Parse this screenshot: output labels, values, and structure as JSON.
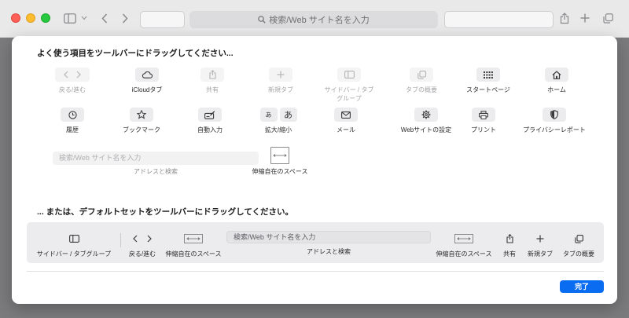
{
  "toolbar": {
    "search_placeholder": "検索/Web サイト名を入力"
  },
  "sheet": {
    "heading_items": "よく使う項目をツールバーにドラッグしてください...",
    "heading_default": "... または、デフォルトセットをツールバーにドラッグしてください。",
    "items_row1": [
      {
        "label": "戻る/進む",
        "icon": "back-forward-icon",
        "enabled": false
      },
      {
        "label": "iCloudタブ",
        "icon": "cloud-icon",
        "enabled": true
      },
      {
        "label": "共有",
        "icon": "share-icon",
        "enabled": false
      },
      {
        "label": "新規タブ",
        "icon": "plus-icon",
        "enabled": false
      },
      {
        "label": "サイドバー / タブ\nグループ",
        "icon": "sidebar-icon",
        "enabled": false
      },
      {
        "label": "タブの概要",
        "icon": "tab-overview-icon",
        "enabled": false
      },
      {
        "label": "スタートページ",
        "icon": "grid-icon",
        "enabled": true
      },
      {
        "label": "ホーム",
        "icon": "home-icon",
        "enabled": true
      }
    ],
    "items_row2": [
      {
        "label": "履歴",
        "icon": "clock-icon",
        "enabled": true
      },
      {
        "label": "ブックマーク",
        "icon": "star-icon",
        "enabled": true
      },
      {
        "label": "自動入力",
        "icon": "autofill-icon",
        "enabled": true
      },
      {
        "label": "拡大/縮小",
        "icon": "text-size-icon",
        "enabled": true,
        "glyphs": [
          "あ",
          "あ"
        ]
      },
      {
        "label": "メール",
        "icon": "mail-icon",
        "enabled": true
      },
      {
        "label": "Webサイトの設定",
        "icon": "gear-icon",
        "enabled": true
      },
      {
        "label": "プリント",
        "icon": "printer-icon",
        "enabled": true
      },
      {
        "label": "プライバシーレポート",
        "icon": "shield-icon",
        "enabled": true
      }
    ],
    "address_placeholder": "検索/Web サイト名を入力",
    "address_label": "アドレスと検索",
    "flex_space_label": "伸縮自在のスペース",
    "default_set": {
      "sidebar_label": "サイドバー / タブグループ",
      "backforward_label": "戻る/進む",
      "flex_label_left": "伸縮自在のスペース",
      "search_placeholder": "検索/Web サイト名を入力",
      "search_label": "アドレスと検索",
      "flex_label_right": "伸縮自在のスペース",
      "share_label": "共有",
      "newtab_label": "新規タブ",
      "overview_label": "タブの概要"
    },
    "done_label": "完了"
  },
  "colors": {
    "accent": "#0a6cf0",
    "window_bg": "#e9e9ea",
    "backdrop": "#7b7b7d"
  }
}
